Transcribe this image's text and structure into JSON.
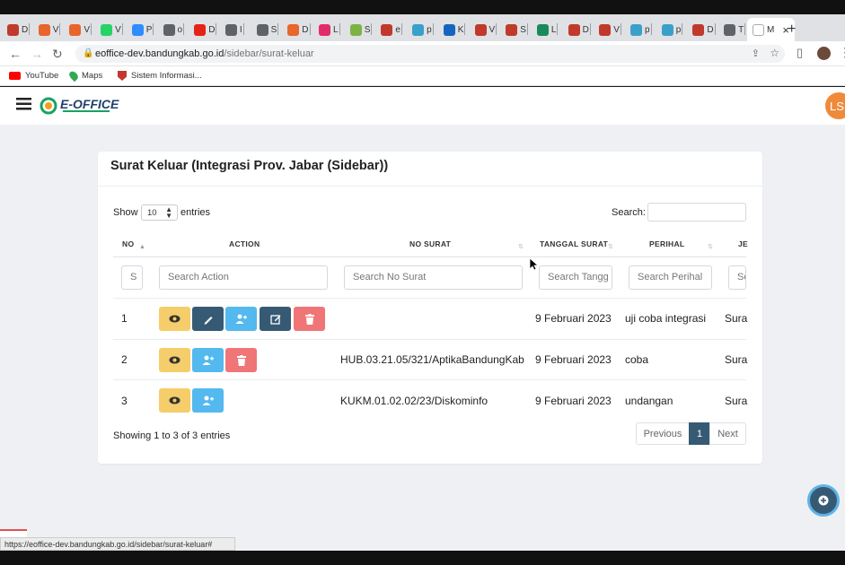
{
  "browser": {
    "tabs": [
      {
        "label": "D",
        "color": "#c0392b"
      },
      {
        "label": "V",
        "color": "#e8652b"
      },
      {
        "label": "V",
        "color": "#e8652b"
      },
      {
        "label": "V",
        "color": "#25d366"
      },
      {
        "label": "P",
        "color": "#2d8cff"
      },
      {
        "label": "o",
        "color": "#5f6368"
      },
      {
        "label": "D",
        "color": "#e62117"
      },
      {
        "label": "I",
        "color": "#5f6368"
      },
      {
        "label": "S",
        "color": "#5f6368"
      },
      {
        "label": "D",
        "color": "#e8652b"
      },
      {
        "label": "L",
        "color": "#e22c6a"
      },
      {
        "label": "S",
        "color": "#7cb342"
      },
      {
        "label": "e",
        "color": "#c0392b"
      },
      {
        "label": "p",
        "color": "#3aa0c9"
      },
      {
        "label": "K",
        "color": "#1565c0"
      },
      {
        "label": "V",
        "color": "#c0392b"
      },
      {
        "label": "S",
        "color": "#c0392b"
      },
      {
        "label": "L",
        "color": "#1a8a5a"
      },
      {
        "label": "D",
        "color": "#c0392b"
      },
      {
        "label": "V",
        "color": "#c0392b"
      },
      {
        "label": "p",
        "color": "#3aa0c9"
      },
      {
        "label": "p",
        "color": "#3aa0c9"
      },
      {
        "label": "D",
        "color": "#c0392b"
      },
      {
        "label": "T",
        "color": "#5f6368"
      }
    ],
    "active_tab": {
      "label": "M",
      "close": "×"
    },
    "new_tab": "+",
    "url_host": "eoffice-dev.bandungkab.go.id",
    "url_path": "/sidebar/surat-keluar",
    "bookmarks": [
      {
        "label": "YouTube",
        "icon": "youtube-icon",
        "color": "#ff0000"
      },
      {
        "label": "Maps",
        "icon": "maps-icon",
        "color": "#34a853"
      },
      {
        "label": "Sistem Informasi...",
        "icon": "bandung-logo-icon",
        "color": "#c0392b"
      }
    ],
    "status_url": "https://eoffice-dev.bandungkab.go.id/sidebar/surat-keluar#"
  },
  "app": {
    "logo_text": "E-OFFICE",
    "avatar_initials": "LS",
    "avatar_color": "#ef8a3a"
  },
  "page": {
    "title": "Surat Keluar (Integrasi Prov. Jabar (Sidebar))",
    "show_label": "Show",
    "entries_value": "10",
    "entries_label": "entries",
    "search_label": "Search:",
    "columns": [
      "NO",
      "ACTION",
      "NO SURAT",
      "TANGGAL SURAT",
      "PERIHAL",
      "JE"
    ],
    "filters": {
      "no": "S",
      "action": "Search Action",
      "no_surat": "Search No Surat",
      "tanggal": "Search Tangg",
      "perihal": "Search Perihal",
      "je": "Se"
    },
    "rows": [
      {
        "no": "1",
        "no_surat": "",
        "tanggal": "9 Februari 2023",
        "perihal": "uji coba integrasi",
        "je": "Sura"
      },
      {
        "no": "2",
        "no_surat": "HUB.03.21.05/321/AptikaBandungKab",
        "tanggal": "9 Februari 2023",
        "perihal": "coba",
        "je": "Sura"
      },
      {
        "no": "3",
        "no_surat": "KUKM.01.02.02/23/Diskominfo",
        "tanggal": "9 Februari 2023",
        "perihal": "undangan",
        "je": "Sura"
      }
    ],
    "info": "Showing 1 to 3 of 3 entries",
    "pagination": {
      "previous": "Previous",
      "current": "1",
      "next": "Next"
    }
  }
}
